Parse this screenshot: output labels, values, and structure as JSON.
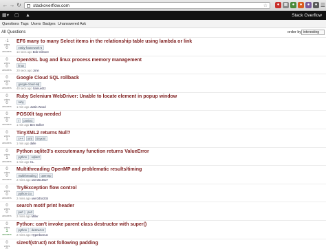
{
  "browser": {
    "url": "stackoverflow.com"
  },
  "site": {
    "brand": "Stack Overflow"
  },
  "nav": {
    "tabs": [
      {
        "label": "Questions"
      },
      {
        "label": "Tags"
      },
      {
        "label": "Users"
      },
      {
        "label": "Badges"
      },
      {
        "label": "Unanswered"
      },
      {
        "label": "Ask"
      }
    ]
  },
  "list": {
    "title": "All Questions",
    "order_label": "order by",
    "order_value": "interesting"
  },
  "questions": [
    {
      "votes": "-1",
      "votes_label": "votes",
      "answers": "0",
      "answers_label": "answers",
      "title": "EF6 many to many Select items in the relationship table using lambda or link",
      "tags": [
        "entity-framework-6"
      ],
      "meta": "14 secs ago",
      "user": "Bob Gilmore",
      "accepted": false
    },
    {
      "votes": "0",
      "votes_label": "votes",
      "answers": "0",
      "answers_label": "answers",
      "title": "OpenSSL bug and linux process memory management",
      "tags": [
        "linux"
      ],
      "meta": "20 secs ago",
      "user": "Jonn",
      "accepted": false
    },
    {
      "votes": "0",
      "votes_label": "votes",
      "answers": "0",
      "answers_label": "answers",
      "title": "Google Cloud SQL rollback",
      "tags": [
        "google-cloud-sql"
      ],
      "meta": "40 secs ago",
      "user": "Samuel22",
      "accepted": false
    },
    {
      "votes": "0",
      "votes_label": "votes",
      "answers": "0",
      "answers_label": "answers",
      "title": "Ruby Selenium WebDriver: Unable to locate element in popup window",
      "tags": [
        "ruby"
      ],
      "meta": "1 min ago",
      "user": "Justin Wood",
      "accepted": false
    },
    {
      "votes": "0",
      "votes_label": "votes",
      "answers": "0",
      "answers_label": "answers",
      "title": "POSIXlt tag needed",
      "tags": [
        "r",
        "posixct"
      ],
      "meta": "1 min ago",
      "user": "Ben Bolker",
      "accepted": false
    },
    {
      "votes": "0",
      "votes_label": "votes",
      "answers": "1",
      "answers_label": "answers",
      "title": "TinyXML2 returns Null?",
      "tags": [
        "c++",
        "xml",
        "tinyxml"
      ],
      "meta": "1 min ago",
      "user": "dalle",
      "accepted": false
    },
    {
      "votes": "0",
      "votes_label": "votes",
      "answers": "1",
      "answers_label": "answers",
      "title": "Python sqlite3's executemany function returns ValueError",
      "tags": [
        "python",
        "sqlite3"
      ],
      "meta": "1 min ago",
      "user": "CL.",
      "accepted": false
    },
    {
      "votes": "0",
      "votes_label": "votes",
      "answers": "0",
      "answers_label": "answers",
      "title": "Multithreading OpenMP and problematic results/timing",
      "tags": [
        "multithreading",
        "openmp"
      ],
      "meta": "2 mins ago",
      "user": "user3516627",
      "accepted": false
    },
    {
      "votes": "0",
      "votes_label": "votes",
      "answers": "0",
      "answers_label": "answers",
      "title": "Try/Exception flow control",
      "tags": [
        "python-3.x"
      ],
      "meta": "2 mins ago",
      "user": "user3454234",
      "accepted": false
    },
    {
      "votes": "0",
      "votes_label": "votes",
      "answers": "0",
      "answers_label": "answers",
      "title": "search motif print header",
      "tags": [
        "perl",
        "perl"
      ],
      "meta": "2 mins ago",
      "user": "Miller",
      "accepted": false
    },
    {
      "votes": "0",
      "votes_label": "votes",
      "answers": "1",
      "answers_label": "answers",
      "title": "Python: can't invoke parent class destructor with super()",
      "tags": [
        "python",
        "destructor"
      ],
      "meta": "2 mins ago",
      "user": "Hyperboreus",
      "accepted": true
    },
    {
      "votes": "0",
      "votes_label": "votes",
      "answers": "0",
      "answers_label": "answers",
      "title": "sizeof(struct) not following padding",
      "tags": [],
      "meta": "",
      "user": "",
      "accepted": false
    }
  ]
}
